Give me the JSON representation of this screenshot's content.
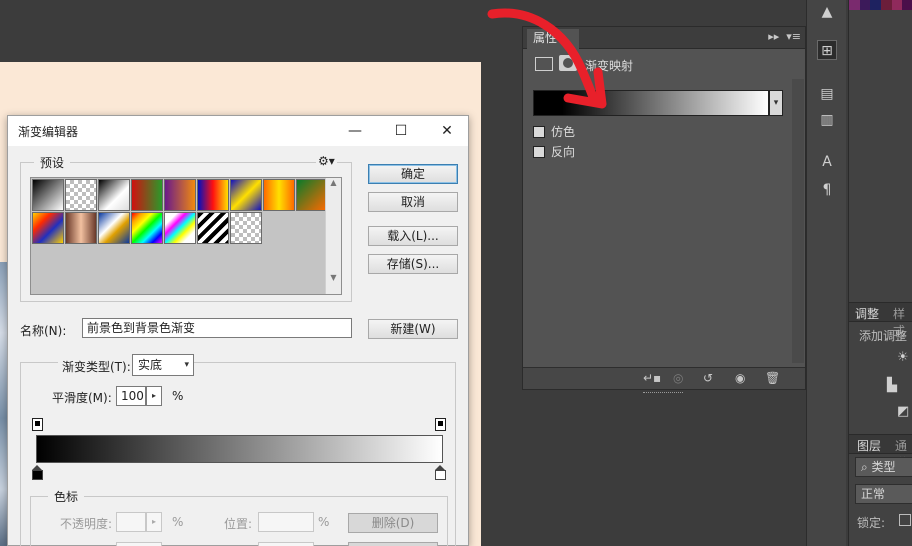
{
  "properties_panel": {
    "tab_label": "属性",
    "adjustment_title": "渐变映射",
    "options": [
      {
        "label": "仿色",
        "checked": false
      },
      {
        "label": "反向",
        "checked": false
      }
    ]
  },
  "right_panels": {
    "adjustments_tab": "调整",
    "styles_tab": "样式",
    "add_adjustment_label": "添加调整",
    "layers_tab": "图层",
    "channels_tab": "通道",
    "filter_type": "类型",
    "blend_mode": "正常",
    "lock_label": "锁定:"
  },
  "gradient_editor": {
    "title": "渐变编辑器",
    "presets_label": "预设",
    "buttons": {
      "ok": "确定",
      "cancel": "取消",
      "load": "载入(L)...",
      "save": "存储(S)...",
      "new": "新建(W)",
      "delete": "删除(D)"
    },
    "name_label": "名称(N):",
    "name_value": "前景色到背景色渐变",
    "gradient_type_label": "渐变类型(T):",
    "gradient_type_value": "实底",
    "smoothness_label": "平滑度(M):",
    "smoothness_value": "100",
    "percent": "%",
    "color_stops_label": "色标",
    "opacity_label": "不透明度:",
    "location_label": "位置:"
  },
  "colors": {
    "annotation_arrow": "#e8202a",
    "dialog_bg": "#f0f0f0",
    "panel_bg": "#535353",
    "canvas_bg": "#fbe8d6"
  }
}
